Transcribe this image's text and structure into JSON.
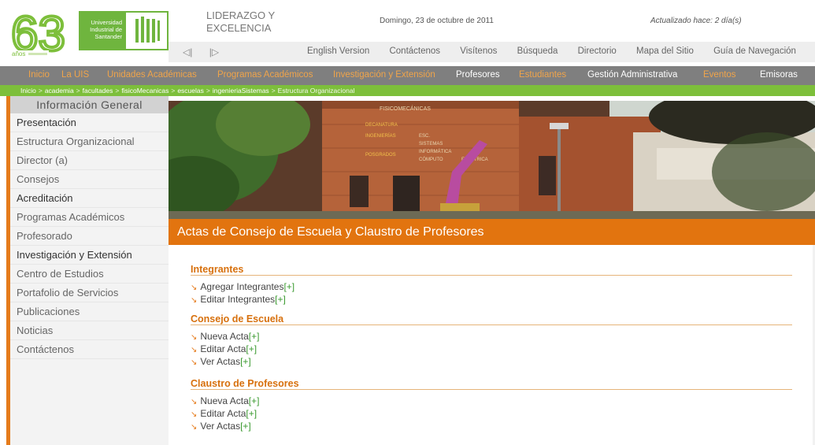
{
  "header": {
    "logo_number": "63",
    "logo_anos": "años",
    "university_name": [
      "Universidad",
      "Industrial de",
      "Santander"
    ],
    "uis_mark": "UIS",
    "motto": [
      "LIDERAZGO Y",
      "EXCELENCIA"
    ],
    "date": "Domingo, 23 de octubre de 2011",
    "updated": "Actualizado hace: 2 día(s)",
    "prev_arrow": "◁|",
    "next_arrow": "|▷",
    "util_links": [
      "English Version",
      "Contáctenos",
      "Visítenos",
      "Búsqueda",
      "Directorio",
      "Mapa del Sitio",
      "Guía de Navegación"
    ]
  },
  "main_nav": [
    {
      "label": "Inicio",
      "color": "#f0a44a"
    },
    {
      "label": "La UIS",
      "color": "#f0a44a"
    },
    {
      "label": "Unidades Académicas",
      "color": "#f0a44a"
    },
    {
      "label": "Programas Académicos",
      "color": "#f0a44a"
    },
    {
      "label": "Investigación y Extensión",
      "color": "#f0a44a"
    },
    {
      "label": "Profesores",
      "color": "#ffffff"
    },
    {
      "label": "Estudiantes",
      "color": "#f0a44a"
    },
    {
      "label": "Gestión Administrativa",
      "color": "#ffffff"
    },
    {
      "label": "Eventos",
      "color": "#f0a44a"
    },
    {
      "label": "Emisoras",
      "color": "#ffffff"
    }
  ],
  "breadcrumb": {
    "items": [
      "Inicio",
      "academia",
      "facultades",
      "fisicoMecanicas",
      "escuelas",
      "ingenieriaSistemas",
      "Estructura Organizacional"
    ],
    "separator": ">"
  },
  "sidebar": {
    "title": "Información General",
    "items": [
      {
        "label": "Presentación",
        "dark": true
      },
      {
        "label": "Estructura Organizacional",
        "dark": false
      },
      {
        "label": "Director (a)",
        "dark": false
      },
      {
        "label": "Consejos",
        "dark": false
      },
      {
        "label": "Acreditación",
        "dark": true
      },
      {
        "label": "Programas Académicos",
        "dark": false
      },
      {
        "label": "Profesorado",
        "dark": false
      },
      {
        "label": "Investigación y Extensión",
        "dark": true
      },
      {
        "label": "Centro de Estudios",
        "dark": false
      },
      {
        "label": "Portafolio de Servicios",
        "dark": false
      },
      {
        "label": "Publicaciones",
        "dark": false
      },
      {
        "label": "Noticias",
        "dark": false
      },
      {
        "label": "Contáctenos",
        "dark": false
      }
    ]
  },
  "banner": {
    "building_signs": [
      "FISICOMECÁNICAS",
      "DECANATURA",
      "INGENIERÍAS",
      "POSGRADOS",
      "ESC.",
      "SISTEMAS",
      "INFORMÁTICA",
      "CÓMPUTO",
      "ELÉCTRICA"
    ]
  },
  "page_title": "Actas de Consejo de Escuela y Claustro de Profesores",
  "sections": [
    {
      "heading": "Integrantes",
      "links": [
        {
          "label": "Agregar Integrantes",
          "plus": "[+]"
        },
        {
          "label": "Editar Integrantes",
          "plus": "[+]"
        }
      ]
    },
    {
      "heading": "Consejo de Escuela",
      "links": [
        {
          "label": "Nueva Acta",
          "plus": "[+]"
        },
        {
          "label": "Editar Acta",
          "plus": "[+]"
        },
        {
          "label": "Ver Actas",
          "plus": "[+]"
        }
      ]
    },
    {
      "heading": "Claustro de Profesores",
      "links": [
        {
          "label": "Nueva Acta",
          "plus": "[+]"
        },
        {
          "label": "Editar Acta",
          "plus": "[+]"
        },
        {
          "label": "Ver Actas",
          "plus": "[+]"
        }
      ]
    }
  ],
  "link_arrow": "↘",
  "colors": {
    "accent_orange": "#e2740f",
    "brand_green": "#7dbf3b",
    "nav_gray": "#7f7f7f"
  }
}
